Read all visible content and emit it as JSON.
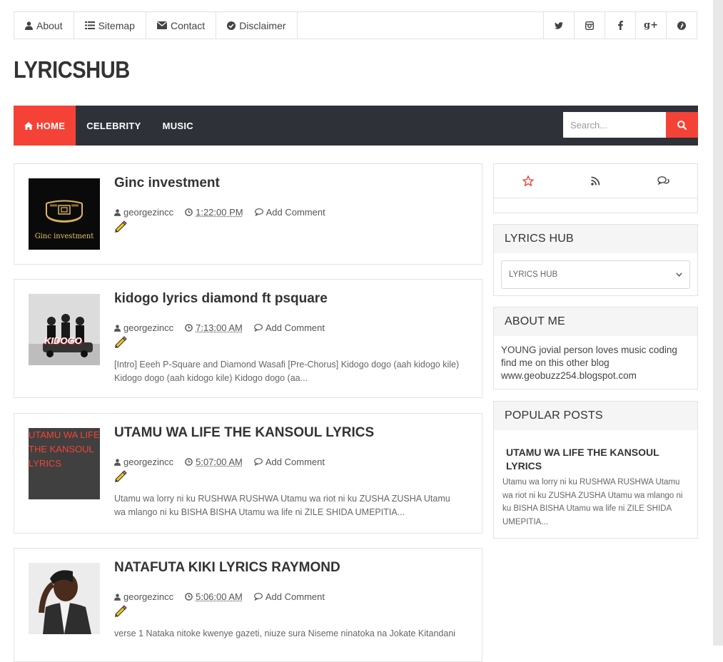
{
  "topbar": {
    "links": [
      {
        "label": "About",
        "icon": "user-icon"
      },
      {
        "label": "Sitemap",
        "icon": "list-icon"
      },
      {
        "label": "Contact",
        "icon": "envelope-icon"
      },
      {
        "label": "Disclaimer",
        "icon": "check-circle-icon"
      }
    ],
    "social": [
      {
        "name": "twitter-icon",
        "glyph": "🐦︎"
      },
      {
        "name": "instagram-icon",
        "glyph": "◙"
      },
      {
        "name": "facebook-icon",
        "glyph": "f"
      },
      {
        "name": "google-plus-icon",
        "glyph": "g+"
      },
      {
        "name": "pinterest-icon",
        "glyph": "℗"
      }
    ]
  },
  "brand": {
    "title": "LYRICSHUB"
  },
  "nav": {
    "items": [
      {
        "label": "HOME",
        "active": true
      },
      {
        "label": "CELEBRITY",
        "active": false
      },
      {
        "label": "MUSIC",
        "active": false
      }
    ],
    "search_placeholder": "Search...",
    "accent_color": "#f44336",
    "bar_color": "#2f3139"
  },
  "posts": [
    {
      "title": "Ginc investment",
      "author": "georgezincc",
      "time": "1:22:00 PM",
      "comments": "Add Comment",
      "snippet": "",
      "thumb_text": "Ginc investment"
    },
    {
      "title": "kidogo lyrics diamond ft psquare",
      "author": "georgezincc",
      "time": "7:13:00 AM",
      "comments": "Add Comment",
      "snippet": "[Intro] Eeeh P-Square and Diamond Wasafi [Pre-Chorus] Kidogo dogo (aah kidogo kile) Kidogo dogo (aah kidogo kile) Kidogo dogo (aa...",
      "thumb_text": "KIDOGO"
    },
    {
      "title": "UTAMU WA LIFE THE KANSOUL LYRICS",
      "author": "georgezincc",
      "time": "5:07:00 AM",
      "comments": "Add Comment",
      "snippet": "Utamu wa lorry ni ku RUSHWA RUSHWA Utamu wa riot ni ku ZUSHA ZUSHA Utamu wa mlango ni ku BISHA BISHA Utamu wa life ni ZILE SHIDA UMEPITIA...",
      "thumb_text": "UTAMU WA LIFE THE KANSOUL LYRICS"
    },
    {
      "title": "NATAFUTA KIKI LYRICS RAYMOND",
      "author": "georgezincc",
      "time": "5:06:00 AM",
      "comments": "Add Comment",
      "snippet": "verse 1 Nataka nitoke kwenye gazeti, niuze sura Niseme ninatoka na Jokate Kitandani",
      "thumb_text": ""
    }
  ],
  "sidebar": {
    "tabs": [
      "star-icon",
      "rss-icon",
      "comments-icon"
    ],
    "lyrics_hub": {
      "title": "LYRICS HUB",
      "selected": "LYRICS HUB"
    },
    "about": {
      "title": "ABOUT ME",
      "text": "YOUNG jovial person loves music coding find me on this other blog www.geobuzz254.blogspot.com"
    },
    "popular": {
      "title": "POPULAR POSTS",
      "post_title": "UTAMU WA LIFE THE KANSOUL LYRICS",
      "post_snippet": "Utamu wa lorry ni ku RUSHWA RUSHWA Utamu wa riot ni ku ZUSHA ZUSHA Utamu wa mlango ni ku BISHA BISHA Utamu wa life ni ZILE SHIDA UMEPITIA..."
    }
  }
}
